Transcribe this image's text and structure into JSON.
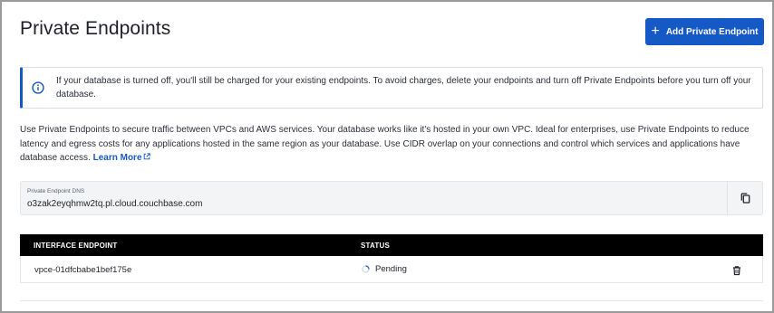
{
  "page": {
    "title": "Private Endpoints"
  },
  "header": {
    "add_button_label": "Add Private Endpoint",
    "add_button_icon": "plus-icon"
  },
  "banner": {
    "icon": "info-icon",
    "text": "If your database is turned off, you'll still be charged for your existing endpoints. To avoid charges, delete your endpoints and turn off Private Endpoints before you turn off your database."
  },
  "description": {
    "text": "Use Private Endpoints to secure traffic between VPCs and AWS services. Your database works like it's hosted in your own VPC. Ideal for enterprises, use Private Endpoints to reduce latency and egress costs for any applications hosted in the same region as your database. Use CIDR overlap on your connections and control which services and applications have database access.",
    "learn_more_label": "Learn More",
    "learn_more_icon": "external-link-icon"
  },
  "dns": {
    "label": "Private Endpoint DNS",
    "value": "o3zak2eyqhmw2tq.pl.cloud.couchbase.com",
    "copy_icon": "copy-icon"
  },
  "table": {
    "columns": [
      "INTERFACE ENDPOINT",
      "STATUS"
    ],
    "rows": [
      {
        "endpoint": "vpce-01dfcbabe1bef175e",
        "status": "Pending",
        "status_icon": "spinner-icon",
        "action_icon": "trash-icon"
      }
    ]
  },
  "colors": {
    "accent": "#1559c7",
    "header_bg": "#000000",
    "dns_bg": "#f3f4f6"
  }
}
